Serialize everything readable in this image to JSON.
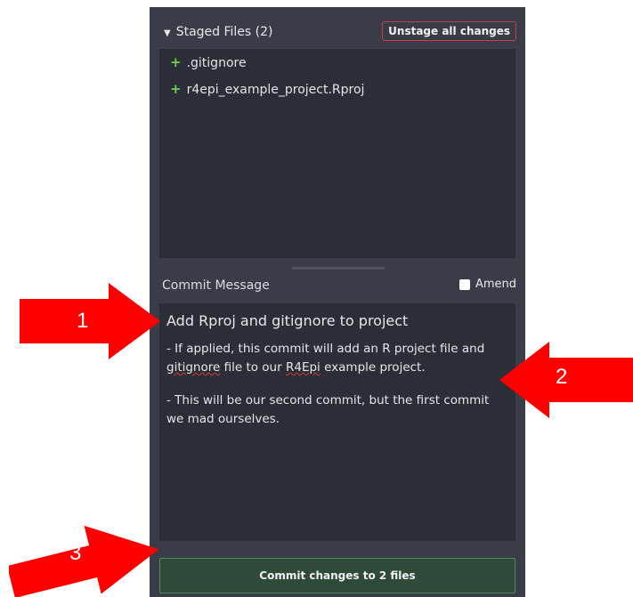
{
  "staged": {
    "caret_icon": "caret-down-icon",
    "title": "Staged Files (2)",
    "unstage_button": "Unstage all changes",
    "files": [
      {
        "status_icon": "plus-icon",
        "name": ".gitignore"
      },
      {
        "status_icon": "plus-icon",
        "name": "r4epi_example_project.Rproj"
      }
    ]
  },
  "commit": {
    "label": "Commit Message",
    "amend_label": "Amend",
    "summary": "Add Rproj and gitignore to project",
    "body_line1_pre": "- If applied, this commit will add an R project file and ",
    "body_line1_word1": "gitignore",
    "body_line1_mid": " file to our ",
    "body_line1_word2": "R4Epi",
    "body_line1_post": " example project.",
    "body_line2": "- This will be our second commit, but the first commit we mad ourselves.",
    "button": "Commit changes to 2 files"
  },
  "annotations": [
    {
      "label": "1",
      "icon": "red-arrow-right"
    },
    {
      "label": "2",
      "icon": "red-arrow-left"
    },
    {
      "label": "3",
      "icon": "red-arrow-up-right"
    }
  ],
  "colors": {
    "panel_bg": "#3a3d47",
    "inset_bg": "#2b2e36",
    "added_green": "#6fcf4a",
    "unstage_border": "#c6404a",
    "commit_btn_bg": "#2e4a39",
    "commit_btn_border": "#4c8a5e",
    "arrow_red": "#ff0000"
  }
}
